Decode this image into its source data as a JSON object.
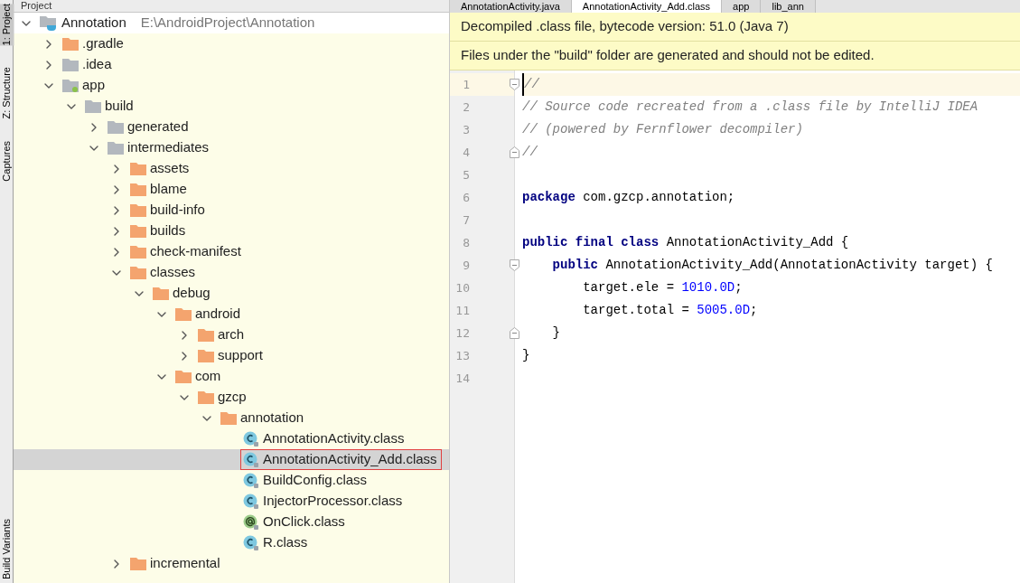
{
  "side_strip": [
    {
      "label": "1: Project",
      "selected": true
    },
    {
      "label": "Z: Structure",
      "selected": false
    },
    {
      "label": "Captures",
      "selected": false
    },
    {
      "label": "Build Variants",
      "selected": false
    }
  ],
  "project_panel": {
    "title": "Project",
    "tree": [
      {
        "label": "Annotation",
        "path": "E:\\AndroidProject\\Annotation",
        "kind": "project",
        "expanded": true,
        "selected": false,
        "children": [
          {
            "label": ".gradle",
            "kind": "excluded",
            "expanded": false,
            "selected": false
          },
          {
            "label": ".idea",
            "kind": "folder",
            "expanded": false,
            "selected": false
          },
          {
            "label": "app",
            "kind": "module",
            "expanded": true,
            "selected": false,
            "children": [
              {
                "label": "build",
                "kind": "folder",
                "expanded": true,
                "selected": false,
                "children": [
                  {
                    "label": "generated",
                    "kind": "folder",
                    "expanded": false,
                    "selected": false
                  },
                  {
                    "label": "intermediates",
                    "kind": "folder",
                    "expanded": true,
                    "selected": false,
                    "children": [
                      {
                        "label": "assets",
                        "kind": "excluded",
                        "expanded": false,
                        "selected": false
                      },
                      {
                        "label": "blame",
                        "kind": "excluded",
                        "expanded": false,
                        "selected": false
                      },
                      {
                        "label": "build-info",
                        "kind": "excluded",
                        "expanded": false,
                        "selected": false
                      },
                      {
                        "label": "builds",
                        "kind": "excluded",
                        "expanded": false,
                        "selected": false
                      },
                      {
                        "label": "check-manifest",
                        "kind": "excluded",
                        "expanded": false,
                        "selected": false
                      },
                      {
                        "label": "classes",
                        "kind": "excluded",
                        "expanded": true,
                        "selected": false,
                        "children": [
                          {
                            "label": "debug",
                            "kind": "excluded",
                            "expanded": true,
                            "selected": false,
                            "children": [
                              {
                                "label": "android",
                                "kind": "excluded",
                                "expanded": true,
                                "selected": false,
                                "children": [
                                  {
                                    "label": "arch",
                                    "kind": "excluded",
                                    "expanded": false,
                                    "selected": false
                                  },
                                  {
                                    "label": "support",
                                    "kind": "excluded",
                                    "expanded": false,
                                    "selected": false
                                  }
                                ]
                              },
                              {
                                "label": "com",
                                "kind": "excluded",
                                "expanded": true,
                                "selected": false,
                                "children": [
                                  {
                                    "label": "gzcp",
                                    "kind": "excluded",
                                    "expanded": true,
                                    "selected": false,
                                    "children": [
                                      {
                                        "label": "annotation",
                                        "kind": "excluded",
                                        "expanded": true,
                                        "selected": false,
                                        "children": [
                                          {
                                            "label": "AnnotationActivity.class",
                                            "kind": "class",
                                            "selected": false,
                                            "highlighted": false
                                          },
                                          {
                                            "label": "AnnotationActivity_Add.class",
                                            "kind": "class",
                                            "selected": true,
                                            "highlighted": true
                                          },
                                          {
                                            "label": "BuildConfig.class",
                                            "kind": "class",
                                            "selected": false,
                                            "highlighted": false
                                          },
                                          {
                                            "label": "InjectorProcessor.class",
                                            "kind": "class",
                                            "selected": false,
                                            "highlighted": false
                                          },
                                          {
                                            "label": "OnClick.class",
                                            "kind": "annotation",
                                            "selected": false,
                                            "highlighted": false
                                          },
                                          {
                                            "label": "R.class",
                                            "kind": "class",
                                            "selected": false,
                                            "highlighted": false
                                          }
                                        ]
                                      }
                                    ]
                                  }
                                ]
                              }
                            ]
                          }
                        ]
                      },
                      {
                        "label": "incremental",
                        "kind": "excluded",
                        "expanded": false,
                        "selected": false
                      }
                    ]
                  }
                ]
              }
            ]
          }
        ]
      }
    ]
  },
  "editor": {
    "tabs": [
      {
        "label": "AnnotationActivity.java",
        "selected": false
      },
      {
        "label": "AnnotationActivity_Add.class",
        "selected": true
      },
      {
        "label": "app",
        "selected": false
      },
      {
        "label": "lib_ann",
        "selected": false
      }
    ],
    "banners": [
      "Decompiled .class file, bytecode version: 51.0 (Java 7)",
      "Files under the \"build\" folder are generated and should not be edited."
    ],
    "lines": [
      {
        "number": "1",
        "current": true,
        "kind": "fold-start",
        "tokens": [
          {
            "kind": "comment",
            "text": "//"
          }
        ]
      },
      {
        "number": "2",
        "current": false,
        "kind": "plain",
        "tokens": [
          {
            "kind": "comment",
            "text": "// Source code recreated from a .class file by IntelliJ IDEA"
          }
        ]
      },
      {
        "number": "3",
        "current": false,
        "kind": "plain",
        "tokens": [
          {
            "kind": "comment",
            "text": "// (powered by Fernflower decompiler)"
          }
        ]
      },
      {
        "number": "4",
        "current": false,
        "kind": "fold-end",
        "tokens": [
          {
            "kind": "comment",
            "text": "//"
          }
        ]
      },
      {
        "number": "5",
        "current": false,
        "kind": "plain"
      },
      {
        "number": "6",
        "current": false,
        "kind": "plain",
        "tokens": [
          {
            "kind": "keyword",
            "text": "package"
          },
          {
            "kind": "plain",
            "text": " com.gzcp.annotation;"
          }
        ]
      },
      {
        "number": "7",
        "current": false,
        "kind": "plain"
      },
      {
        "number": "8",
        "current": false,
        "kind": "plain",
        "tokens": [
          {
            "kind": "keyword",
            "text": "public final class"
          },
          {
            "kind": "plain",
            "text": " AnnotationActivity_Add {"
          }
        ]
      },
      {
        "number": "9",
        "current": false,
        "kind": "fold-start",
        "tokens": [
          {
            "kind": "keyword",
            "text": "    public"
          },
          {
            "kind": "plain",
            "text": " AnnotationActivity_Add(AnnotationActivity target) {"
          }
        ]
      },
      {
        "number": "10",
        "current": false,
        "kind": "plain",
        "tokens": [
          {
            "kind": "plain",
            "text": "        target.ele = "
          },
          {
            "kind": "number",
            "text": "1010.0D"
          },
          {
            "kind": "plain",
            "text": ";"
          }
        ]
      },
      {
        "number": "11",
        "current": false,
        "kind": "plain",
        "tokens": [
          {
            "kind": "plain",
            "text": "        target.total = "
          },
          {
            "kind": "number",
            "text": "5005.0D"
          },
          {
            "kind": "plain",
            "text": ";"
          }
        ]
      },
      {
        "number": "12",
        "current": false,
        "kind": "fold-end",
        "tokens": [
          {
            "kind": "plain",
            "text": "    }"
          }
        ]
      },
      {
        "number": "13",
        "current": false,
        "kind": "plain",
        "tokens": [
          {
            "kind": "plain",
            "text": "}"
          }
        ]
      },
      {
        "number": "14",
        "current": false,
        "kind": "plain"
      }
    ]
  }
}
